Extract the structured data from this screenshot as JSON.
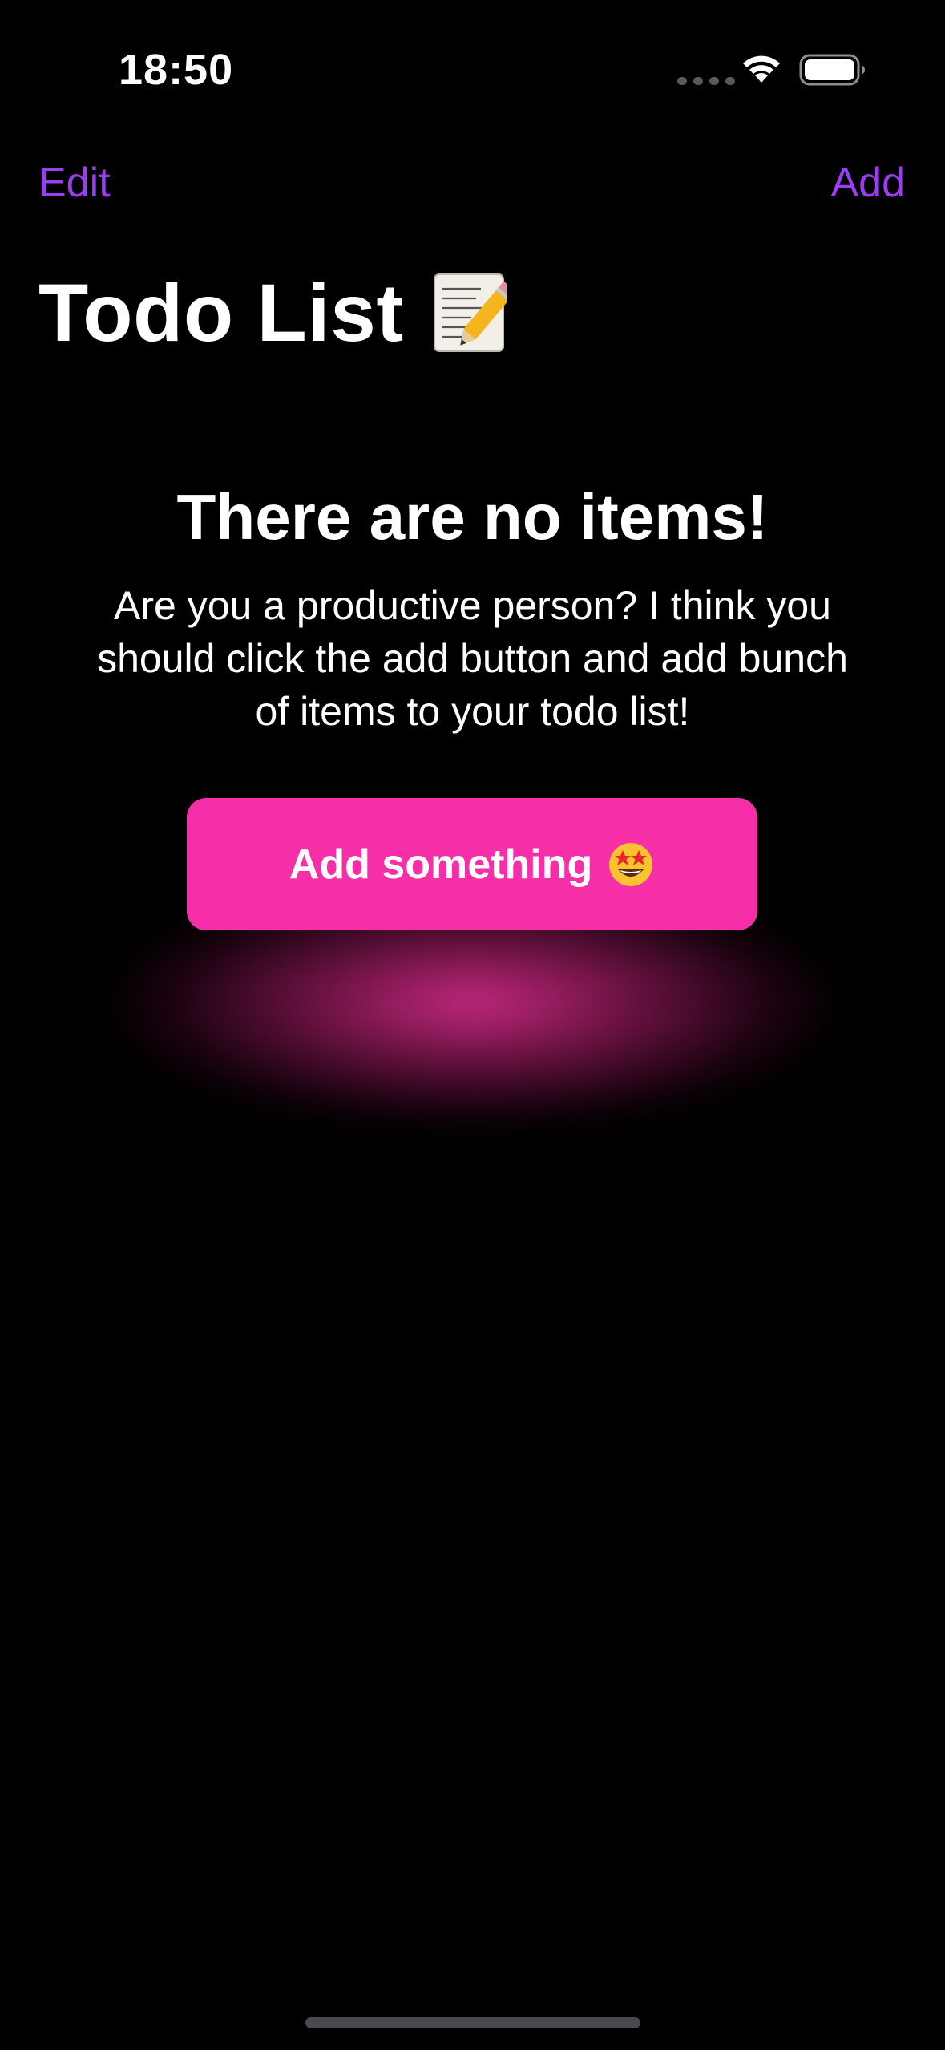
{
  "status_bar": {
    "time": "18:50",
    "icons": [
      "cellular-signal-icon",
      "wifi-icon",
      "battery-icon"
    ]
  },
  "nav": {
    "edit_label": "Edit",
    "add_label": "Add"
  },
  "page": {
    "title": "Todo List",
    "title_icon": "memo-pencil-icon"
  },
  "empty_state": {
    "heading": "There are no items!",
    "message": "Are you a productive person? I think you should click the add button and add bunch of items to your todo list!",
    "button_label": "Add something",
    "button_icon": "star-struck-face-icon"
  },
  "colors": {
    "background": "#000000",
    "accent": "#9A3EF2",
    "button": "#F62FA8",
    "text": "#FFFFFF"
  }
}
